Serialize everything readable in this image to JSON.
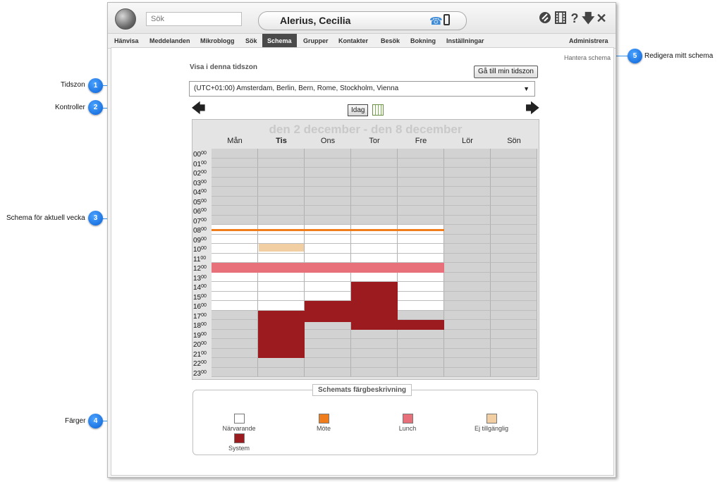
{
  "callouts": [
    {
      "num": "1",
      "label": "Tidszon"
    },
    {
      "num": "2",
      "label": "Kontroller"
    },
    {
      "num": "3",
      "label": "Schema för aktuell vecka"
    },
    {
      "num": "4",
      "label": "Färger"
    },
    {
      "num": "5",
      "label": "Redigera mitt schema"
    }
  ],
  "header": {
    "search_placeholder": "Sök",
    "user_name": "Alerius, Cecilia",
    "icons": [
      "globe-logo-icon",
      "phone-icon",
      "mobile-icon",
      "logout-icon",
      "film-icon",
      "help-icon",
      "download-icon",
      "close-icon"
    ]
  },
  "menu": {
    "items": [
      "Hänvisa",
      "Meddelanden",
      "Mikroblogg",
      "Sök",
      "Schema",
      "Grupper",
      "Kontakter",
      "Besök",
      "Bokning",
      "Inställningar"
    ],
    "active": "Schema",
    "admin": "Administrera"
  },
  "manage_schedule_link": "Hantera schema",
  "timezone": {
    "heading": "Visa i denna tidszon",
    "goto_button": "Gå till min tidszon",
    "selected": "(UTC+01:00) Amsterdam, Berlin, Bern, Rome, Stockholm, Vienna"
  },
  "controls": {
    "prev_icon": "arrow-left-icon",
    "next_icon": "arrow-right-icon",
    "today_button": "Idag",
    "calendar_icon": "calendar-icon"
  },
  "schedule": {
    "week_title": "den 2 december - den 8 december",
    "days": [
      "Mån",
      "Tis",
      "Ons",
      "Tor",
      "Fre",
      "Lör",
      "Sön"
    ],
    "today": "Tis",
    "hours": [
      "00",
      "01",
      "02",
      "03",
      "04",
      "05",
      "06",
      "07",
      "08",
      "09",
      "10",
      "11",
      "12",
      "13",
      "14",
      "15",
      "16",
      "17",
      "18",
      "19",
      "20",
      "21",
      "22",
      "23"
    ],
    "minute_suffix": "00"
  },
  "legend": {
    "title": "Schemats färgbeskrivning",
    "items": [
      {
        "label": "Närvarande",
        "color": "#ffffff"
      },
      {
        "label": "Möte",
        "color": "#f07d1c"
      },
      {
        "label": "Lunch",
        "color": "#e8707a"
      },
      {
        "label": "Ej tillgänglig",
        "color": "#f2cfa3"
      },
      {
        "label": "System",
        "color": "#9b1b1f"
      }
    ]
  },
  "colors": {
    "present": "#ffffff",
    "meeting": "#f07d1c",
    "lunch": "#e8707a",
    "unavailable": "#f2cfa3",
    "system": "#9b1b1f",
    "off_hours": "#d2d2d2",
    "menu_active": "#4a4a4a"
  }
}
